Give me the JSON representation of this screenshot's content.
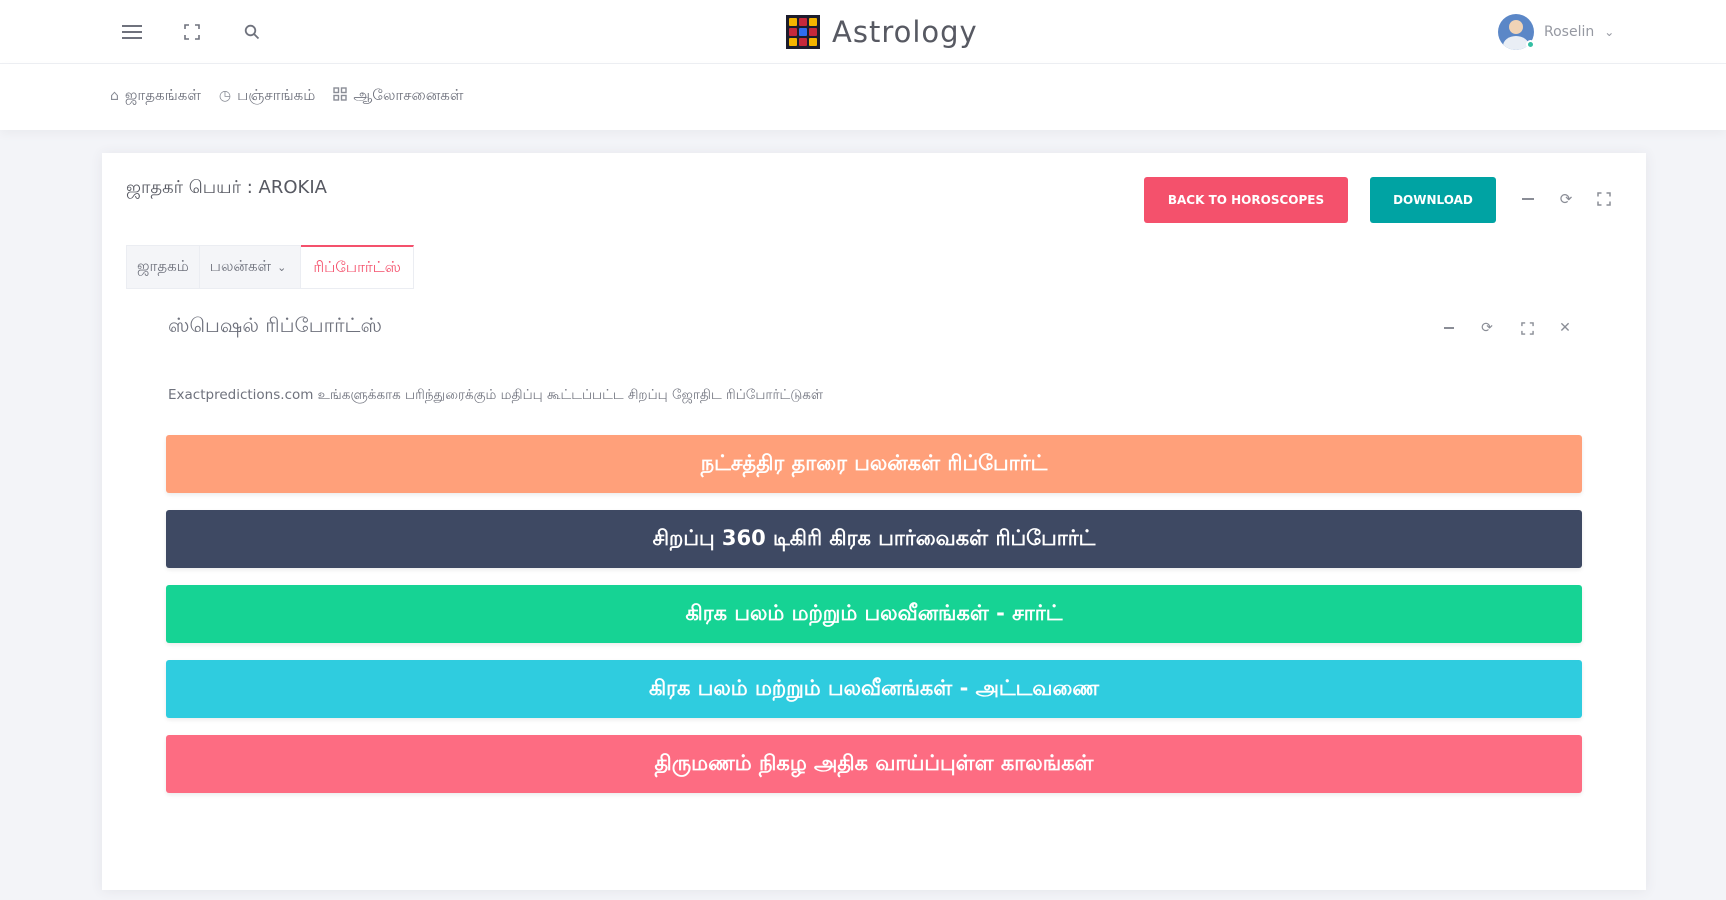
{
  "app": {
    "title": "Astrology",
    "user_name": "Roselin"
  },
  "topbar_icons": [
    "menu-icon",
    "fullscreen-icon",
    "search-icon"
  ],
  "subnav": {
    "items": [
      {
        "icon": "home-icon",
        "label": "ஜாதகங்கள்"
      },
      {
        "icon": "clock-icon",
        "label": "பஞ்சாங்கம்"
      },
      {
        "icon": "grid-icon",
        "label": "ஆலோசனைகள்"
      }
    ]
  },
  "card": {
    "title": "ஜாதகர் பெயர் : AROKIA",
    "back_button": "BACK TO HOROSCOPES",
    "download_button": "DOWNLOAD"
  },
  "tabs": [
    {
      "label": "ஜாதகம்",
      "active": false
    },
    {
      "label": "பலன்கள்",
      "active": false,
      "dropdown": true
    },
    {
      "label": "ரிப்போர்ட்ஸ்",
      "active": true
    }
  ],
  "portlet": {
    "title": "ஸ்பெஷல் ரிப்போர்ட்ஸ்",
    "description": "Exactpredictions.com உங்களுக்காக பரிந்துரைக்கும் மதிப்பு கூட்டப்பட்ட சிறப்பு ஜோதிட ரிப்போர்ட்டுகள்"
  },
  "reports": [
    {
      "label": "நட்சத்திர தாரை பலன்கள் ரிப்போர்ட்",
      "color": "#ffa07a"
    },
    {
      "label": "சிறப்பு 360 டிகிரி கிரக பார்வைகள் ரிப்போர்ட்",
      "color": "#3e4963"
    },
    {
      "label": "கிரக பலம் மற்றும் பலவீனங்கள் - சார்ட்",
      "color": "#16d394"
    },
    {
      "label": "கிரக பலம் மற்றும் பலவீனங்கள் - அட்டவணை",
      "color": "#2fccdf"
    },
    {
      "label": "திருமணம் நிகழ அதிக வாய்ப்புள்ள காலங்கள்",
      "color": "#fd6c82"
    }
  ]
}
